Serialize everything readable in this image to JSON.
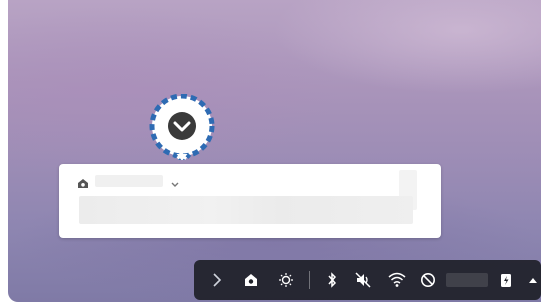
{
  "icons": {
    "callout_expand": "chevron-down-icon",
    "notification_app": "home-icon",
    "notification_expand": "chevron-down-icon",
    "shelf_forward": "chevron-right-icon",
    "shelf_home": "home-icon",
    "shelf_brightness": "brightness-icon",
    "shelf_bluetooth": "bluetooth-icon",
    "shelf_mute": "volume-mute-icon",
    "shelf_wifi": "wifi-icon",
    "shelf_dnd": "do-not-disturb-icon",
    "shelf_battery": "battery-charging-icon",
    "shelf_up": "caret-up-icon"
  },
  "colors": {
    "callout_border": "#2e6bb3",
    "callout_chevron": "#2f2f2f",
    "shelf_bg": "#1e2028"
  }
}
